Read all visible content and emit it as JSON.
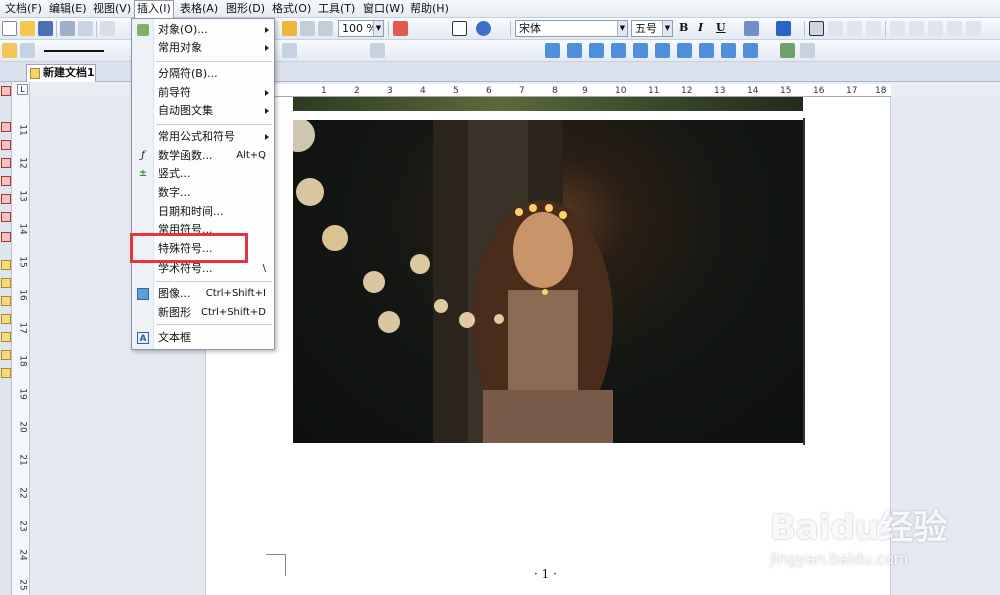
{
  "menubar": {
    "items": [
      {
        "label": "文档(F)"
      },
      {
        "label": "编辑(E)"
      },
      {
        "label": "视图(V)"
      },
      {
        "label": "插入(I)"
      },
      {
        "label": "表格(A)"
      },
      {
        "label": "图形(D)"
      },
      {
        "label": "格式(O)"
      },
      {
        "label": "工具(T)"
      },
      {
        "label": "窗口(W)"
      },
      {
        "label": "帮助(H)"
      }
    ]
  },
  "toolbar": {
    "zoom": "100 %",
    "font_name": "宋体",
    "font_size": "五号",
    "bold": "B",
    "italic": "I",
    "underline": "U"
  },
  "tab": {
    "label": "新建文档1"
  },
  "insert_menu": {
    "items": [
      {
        "label": "对象(O)...",
        "shortcut": "",
        "submenu": true
      },
      {
        "label": "常用对象",
        "shortcut": "",
        "submenu": true
      },
      {
        "label": "分隔符(B)...",
        "shortcut": "",
        "submenu": false
      },
      {
        "label": "前导符",
        "shortcut": "",
        "submenu": true
      },
      {
        "label": "自动图文集",
        "shortcut": "",
        "submenu": true
      },
      {
        "label": "常用公式和符号",
        "shortcut": "",
        "submenu": true
      },
      {
        "label": "数学函数...",
        "shortcut": "Alt+Q",
        "submenu": false,
        "icon": "fx-icon"
      },
      {
        "label": "竖式...",
        "shortcut": "",
        "submenu": false,
        "icon": "vertical-calc-icon"
      },
      {
        "label": "数字...",
        "shortcut": "",
        "submenu": false
      },
      {
        "label": "日期和时间...",
        "shortcut": "",
        "submenu": false
      },
      {
        "label": "常用符号...",
        "shortcut": "",
        "submenu": false
      },
      {
        "label": "特殊符号...",
        "shortcut": "",
        "submenu": false
      },
      {
        "label": "学术符号...",
        "shortcut": "\\",
        "submenu": false
      },
      {
        "label": "图像...",
        "shortcut": "Ctrl+Shift+I",
        "submenu": false,
        "icon": "image-icon"
      },
      {
        "label": "新图形",
        "shortcut": "Ctrl+Shift+D",
        "submenu": false
      },
      {
        "label": "文本框",
        "shortcut": "",
        "submenu": false,
        "icon": "textbox-icon"
      }
    ]
  },
  "ruler": {
    "h_ticks": [
      "2",
      "1",
      "1",
      "2",
      "3",
      "4",
      "5",
      "6",
      "7",
      "8",
      "9",
      "10",
      "11",
      "12",
      "13",
      "14",
      "15",
      "16",
      "17",
      "18"
    ],
    "v_ticks": [
      "11",
      "12",
      "13",
      "14",
      "15",
      "16",
      "17",
      "18",
      "19",
      "20",
      "21",
      "22",
      "23",
      "24",
      "25"
    ],
    "corner": "L"
  },
  "document": {
    "page_number": "· 1 ·"
  },
  "watermark": {
    "logo": "Baidu经验",
    "url": "jingyan.baidu.com"
  }
}
